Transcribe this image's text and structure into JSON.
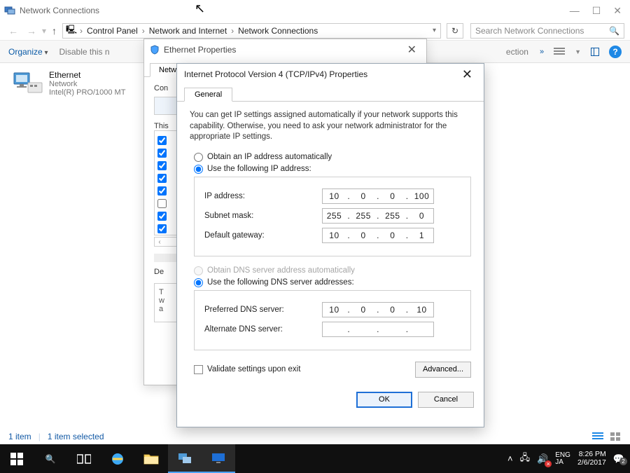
{
  "window": {
    "title": "Network Connections",
    "minimize": "—",
    "maximize": "☐",
    "close": "✕"
  },
  "nav": {
    "back": "←",
    "forward": "→",
    "up": "↑",
    "refresh": "↻"
  },
  "breadcrumb": {
    "root_glyph": "🖳",
    "items": [
      "Control Panel",
      "Network and Internet",
      "Network Connections"
    ]
  },
  "search": {
    "placeholder": "Search Network Connections",
    "glass": "🔍"
  },
  "toolbar": {
    "organize": "Organize",
    "disable": "Disable this n",
    "connection_suffix": "ection",
    "chev": "»"
  },
  "adapter": {
    "name": "Ethernet",
    "line2": "Network",
    "line3": "Intel(R) PRO/1000 MT"
  },
  "status": {
    "count": "1 item",
    "selected": "1 item selected"
  },
  "eth_dialog": {
    "title": "Ethernet Properties",
    "tab": "Netwo",
    "connect_label": "Con",
    "this_label": "This",
    "desc_label": "De",
    "desc_t": "T",
    "desc_w": "w",
    "desc_a": "a",
    "checks": [
      true,
      true,
      true,
      true,
      true,
      false,
      true,
      true
    ],
    "scroll_left": "‹",
    "scroll_right": "›"
  },
  "ipv4_dialog": {
    "title": "Internet Protocol Version 4 (TCP/IPv4) Properties",
    "tab": "General",
    "intro": "You can get IP settings assigned automatically if your network supports this capability. Otherwise, you need to ask your network administrator for the appropriate IP settings.",
    "radio_auto_ip": "Obtain an IP address automatically",
    "radio_static_ip": "Use the following IP address:",
    "ip_label": "IP address:",
    "ip_value": [
      "10",
      "0",
      "0",
      "100"
    ],
    "mask_label": "Subnet mask:",
    "mask_value": [
      "255",
      "255",
      "255",
      "0"
    ],
    "gw_label": "Default gateway:",
    "gw_value": [
      "10",
      "0",
      "0",
      "1"
    ],
    "radio_auto_dns": "Obtain DNS server address automatically",
    "radio_static_dns": "Use the following DNS server addresses:",
    "dns1_label": "Preferred DNS server:",
    "dns1_value": [
      "10",
      "0",
      "0",
      "10"
    ],
    "dns2_label": "Alternate DNS server:",
    "dns2_value": [
      "",
      "",
      "",
      ""
    ],
    "validate_label": "Validate settings upon exit",
    "advanced": "Advanced...",
    "ok": "OK",
    "cancel": "Cancel"
  },
  "taskbar": {
    "lang_top": "ENG",
    "lang_bottom": "JA",
    "time": "8:26 PM",
    "date": "2/6/2017",
    "tray_up": "˄",
    "badge": "2"
  }
}
